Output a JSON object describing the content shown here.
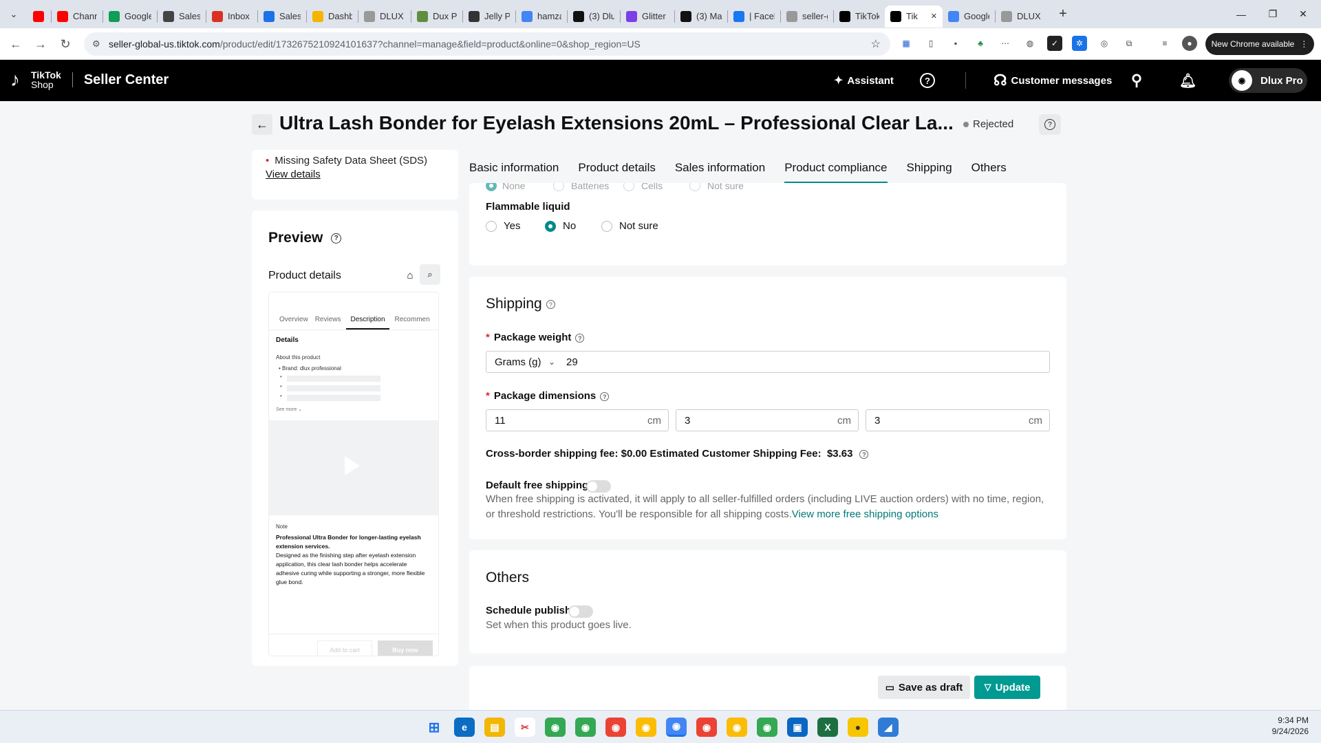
{
  "browser": {
    "tabs": [
      {
        "title": "",
        "favicon": "youtube-icon",
        "color": "#ff0000"
      },
      {
        "title": "Channe",
        "favicon": "youtube-icon",
        "color": "#ff0000"
      },
      {
        "title": "Google",
        "favicon": "sheets-icon",
        "color": "#0f9d58"
      },
      {
        "title": "Sales T",
        "favicon": "sales-icon",
        "color": "#444444"
      },
      {
        "title": "Inbox (",
        "favicon": "gmail-icon",
        "color": "#d93025"
      },
      {
        "title": "Sales &",
        "favicon": "s-icon",
        "color": "#1a73e8"
      },
      {
        "title": "Dashb",
        "favicon": "bars-icon",
        "color": "#f4b400"
      },
      {
        "title": "DLUX F",
        "favicon": "globe-icon",
        "color": "#999999"
      },
      {
        "title": "Dux Pr",
        "favicon": "shopify-icon",
        "color": "#5e8e3e"
      },
      {
        "title": "Jelly Pa",
        "favicon": "camera-icon",
        "color": "#333333"
      },
      {
        "title": "hamza",
        "favicon": "doc-icon",
        "color": "#4285f4"
      },
      {
        "title": "(3) Dlu",
        "favicon": "notion-icon",
        "color": "#111111"
      },
      {
        "title": "Glitter",
        "favicon": "g-icon",
        "color": "#7b3fe4"
      },
      {
        "title": "(3) Ma",
        "favicon": "notion-icon",
        "color": "#111111"
      },
      {
        "title": "| Faceb",
        "favicon": "facebook-icon",
        "color": "#1877f2"
      },
      {
        "title": "seller-g",
        "favicon": "globe-icon",
        "color": "#999999"
      },
      {
        "title": "TikTok",
        "favicon": "tiktok-icon",
        "color": "#000000"
      },
      {
        "title": "Tik",
        "favicon": "tiktok-icon",
        "color": "#000000",
        "active": true
      },
      {
        "title": "Google",
        "favicon": "doc-icon",
        "color": "#4285f4"
      },
      {
        "title": "DLUX F",
        "favicon": "globe-icon",
        "color": "#999999"
      }
    ],
    "url_host": "seller-global-us.tiktok.com",
    "url_path": "/product/edit/1732675210924101637?channel=manage&field=product&online=0&shop_region=US",
    "new_chrome": "New Chrome available"
  },
  "header": {
    "brand_top": "TikTok",
    "brand_bottom": "Shop",
    "app_name": "Seller Center",
    "assistant": "Assistant",
    "customer_messages": "Customer messages",
    "account_name": "Dlux Pro"
  },
  "page": {
    "title": "Ultra Lash Bonder for Eyelash Extensions 20mL – Professional Clear La...",
    "status": "Rejected"
  },
  "issue": {
    "text": "Missing Safety Data Sheet (SDS)",
    "link": "View details"
  },
  "preview": {
    "title": "Preview",
    "subtitle": "Product details",
    "tabs": [
      "Overview",
      "Reviews",
      "Description",
      "Recommen"
    ],
    "details_label": "Details",
    "about_label": "About this product",
    "brand_line": "Brand: dlux professional",
    "see_more": "See more",
    "note_label": "Note",
    "note_bold": "Professional Ultra Bonder for longer-lasting eyelash extension services.",
    "note_text": "Designed as the finishing step after eyelash extension application, this clear lash bonder helps accelerate adhesive curing while supporting a stronger, more flexible glue bond.",
    "add_to_cart": "Add to cart",
    "buy_now": "Buy now"
  },
  "form_tabs": [
    {
      "label": "Basic information"
    },
    {
      "label": "Product details"
    },
    {
      "label": "Sales information"
    },
    {
      "label": "Product compliance",
      "active": true
    },
    {
      "label": "Shipping"
    },
    {
      "label": "Others"
    }
  ],
  "compliance": {
    "cut_options": [
      "None",
      "Batteries",
      "Cells",
      "Not sure"
    ],
    "flammable_label": "Flammable liquid",
    "flammable_options": [
      {
        "label": "Yes",
        "selected": false
      },
      {
        "label": "No",
        "selected": true
      },
      {
        "label": "Not sure",
        "selected": false
      }
    ]
  },
  "shipping": {
    "title": "Shipping",
    "weight_label": "Package weight",
    "weight_unit": "Grams (g)",
    "weight_value": "29",
    "dimensions_label": "Package dimensions",
    "dimensions": [
      "11",
      "3",
      "3"
    ],
    "dimension_unit": "cm",
    "fee_text": "Cross-border shipping fee: $0.00 Estimated Customer Shipping Fee:",
    "fee_value": "$3.63",
    "free_shipping_label": "Default free shipping",
    "free_shipping_enabled": false,
    "free_shipping_desc": "When free shipping is activated, it will apply to all seller-fulfilled orders (including LIVE auction orders) with no time, region, or threshold restrictions. You'll be responsible for all shipping costs.",
    "free_shipping_link": "View more free shipping options"
  },
  "others": {
    "title": "Others",
    "schedule_label": "Schedule publish",
    "schedule_enabled": false,
    "schedule_desc": "Set when this product goes live."
  },
  "actions": {
    "save_draft": "Save as draft",
    "update": "Update"
  },
  "taskbar": {
    "time": "9:34 PM",
    "date": "9/24/2026"
  },
  "colors": {
    "accent": "#009a93",
    "link": "#00787a",
    "required": "#e0282e"
  }
}
